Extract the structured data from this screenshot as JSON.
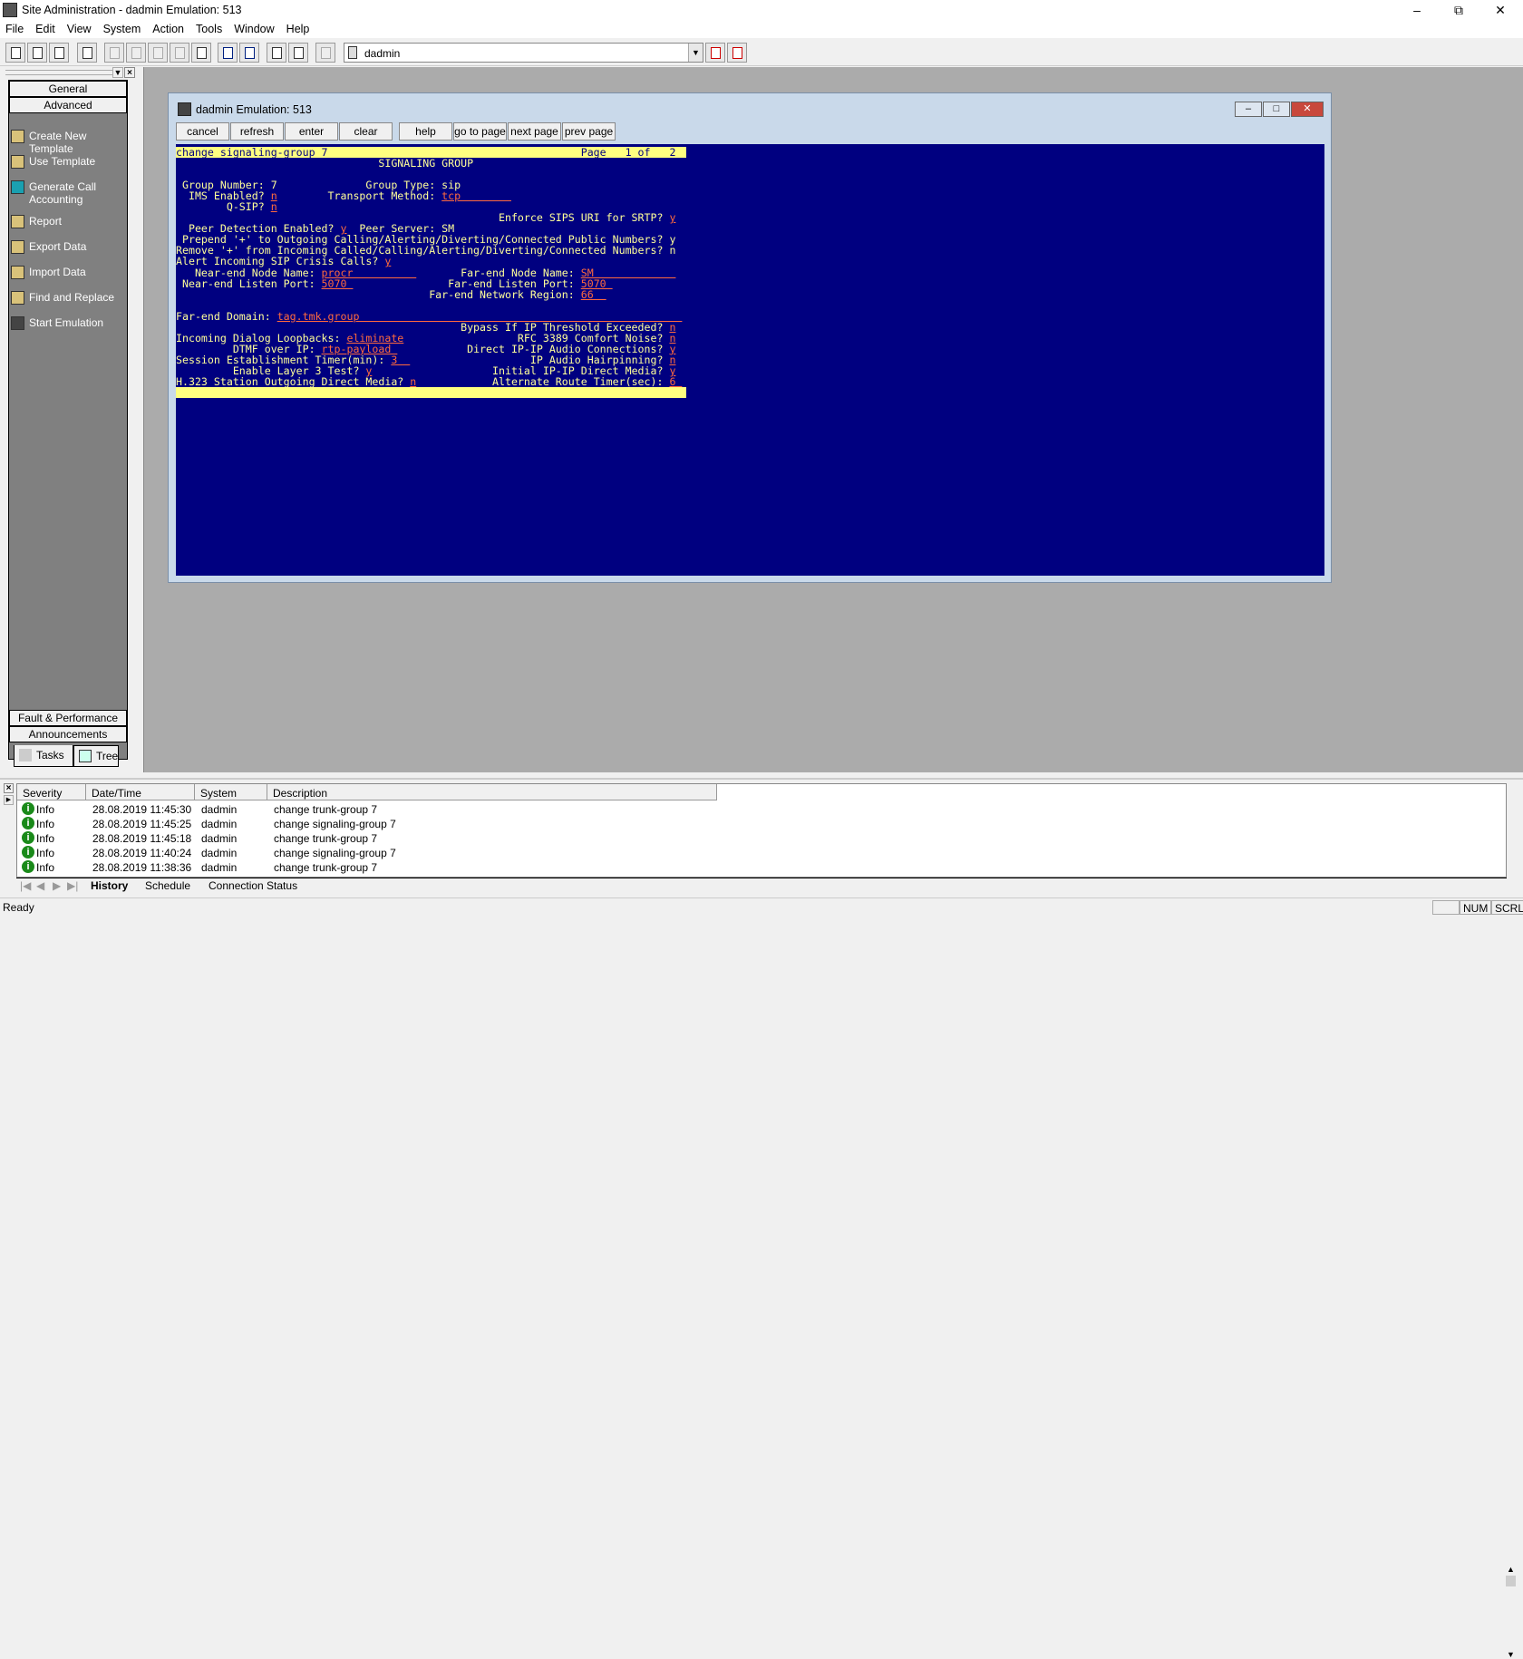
{
  "app": {
    "title": "Site Administration - dadmin Emulation: 513"
  },
  "menu": [
    "File",
    "Edit",
    "View",
    "System",
    "Action",
    "Tools",
    "Window",
    "Help"
  ],
  "toolbar": {
    "system_combo": "dadmin"
  },
  "left_panel": {
    "top_buttons": [
      "General",
      "Advanced"
    ],
    "items": [
      "Create New Template",
      "Use Template",
      "Generate Call Accounting",
      "Report",
      "Export Data",
      "Import Data",
      "Find and Replace",
      "Start Emulation"
    ],
    "bottom_buttons": [
      "Fault & Performance",
      "Announcements"
    ],
    "tabs": [
      "Tasks",
      "Tree"
    ]
  },
  "emulation": {
    "title": "dadmin Emulation: 513",
    "buttons": [
      "cancel",
      "refresh",
      "enter",
      "clear",
      "help",
      "go to page",
      "next page",
      "prev page"
    ],
    "colors": {
      "background": "#000080",
      "label": "#ffff99",
      "value": "#ff6a3d",
      "highlight": "#ffff80"
    },
    "screen": [
      {
        "hl": true,
        "segs": [
          [
            "change signaling-group 7                                        Page   1 of   2 ",
            "l"
          ]
        ]
      },
      {
        "segs": [
          [
            "                                SIGNALING GROUP",
            "l"
          ]
        ]
      },
      {
        "segs": []
      },
      {
        "segs": [
          [
            " Group Number: 7              Group Type: sip",
            "l"
          ]
        ]
      },
      {
        "segs": [
          [
            "  IMS Enabled? ",
            "l"
          ],
          [
            "n",
            "v"
          ],
          [
            "        Transport Method: ",
            "l"
          ],
          [
            "tcp        ",
            "v"
          ]
        ]
      },
      {
        "segs": [
          [
            "        Q-SIP? ",
            "l"
          ],
          [
            "n",
            "v"
          ]
        ]
      },
      {
        "segs": [
          [
            "                                                   Enforce SIPS URI for SRTP? ",
            "l"
          ],
          [
            "y",
            "v"
          ]
        ]
      },
      {
        "segs": [
          [
            "  Peer Detection Enabled? ",
            "l"
          ],
          [
            "y",
            "v"
          ],
          [
            "  Peer Server: SM",
            "l"
          ]
        ]
      },
      {
        "segs": [
          [
            " Prepend '+' to Outgoing Calling/Alerting/Diverting/Connected Public Numbers? y",
            "l"
          ]
        ]
      },
      {
        "segs": [
          [
            "Remove '+' from Incoming Called/Calling/Alerting/Diverting/Connected Numbers? n",
            "l"
          ]
        ]
      },
      {
        "segs": [
          [
            "Alert Incoming SIP Crisis Calls? ",
            "l"
          ],
          [
            "y",
            "v"
          ]
        ]
      },
      {
        "segs": [
          [
            "   Near-end Node Name: ",
            "l"
          ],
          [
            "procr          ",
            "v"
          ],
          [
            "       Far-end Node Name: ",
            "l"
          ],
          [
            "SM             ",
            "v"
          ]
        ]
      },
      {
        "segs": [
          [
            " Near-end Listen Port: ",
            "l"
          ],
          [
            "5070 ",
            "v"
          ],
          [
            "               Far-end Listen Port: ",
            "l"
          ],
          [
            "5070 ",
            "v"
          ]
        ]
      },
      {
        "segs": [
          [
            "                                        Far-end Network Region: ",
            "l"
          ],
          [
            "66  ",
            "v"
          ]
        ]
      },
      {
        "segs": []
      },
      {
        "segs": [
          [
            "Far-end Domain: ",
            "l"
          ],
          [
            "tag.tmk.group                                                   ",
            "v"
          ]
        ]
      },
      {
        "segs": [
          [
            "                                             Bypass If IP Threshold Exceeded? ",
            "l"
          ],
          [
            "n",
            "v"
          ]
        ]
      },
      {
        "segs": [
          [
            "Incoming Dialog Loopbacks: ",
            "l"
          ],
          [
            "eliminate",
            "v"
          ],
          [
            "                  RFC 3389 Comfort Noise? ",
            "l"
          ],
          [
            "n",
            "v"
          ]
        ]
      },
      {
        "segs": [
          [
            "         DTMF over IP: ",
            "l"
          ],
          [
            "rtp-payload ",
            "v"
          ],
          [
            "           Direct IP-IP Audio Connections? ",
            "l"
          ],
          [
            "y",
            "v"
          ]
        ]
      },
      {
        "segs": [
          [
            "Session Establishment Timer(min): ",
            "l"
          ],
          [
            "3  ",
            "v"
          ],
          [
            "                   IP Audio Hairpinning? ",
            "l"
          ],
          [
            "n",
            "v"
          ]
        ]
      },
      {
        "segs": [
          [
            "         Enable Layer 3 Test? ",
            "l"
          ],
          [
            "y",
            "v"
          ],
          [
            "                   Initial IP-IP Direct Media? ",
            "l"
          ],
          [
            "y",
            "v"
          ]
        ]
      },
      {
        "segs": [
          [
            "H.323 Station Outgoing Direct Media? ",
            "l"
          ],
          [
            "n",
            "v"
          ],
          [
            "            Alternate Route Timer(sec): ",
            "l"
          ],
          [
            "6 ",
            "v"
          ]
        ]
      },
      {
        "hl": true,
        "segs": [
          [
            "                                                                                ",
            "l"
          ]
        ]
      }
    ]
  },
  "log": {
    "columns": [
      "Severity",
      "Date/Time",
      "System",
      "Description"
    ],
    "rows": [
      {
        "severity": "Info",
        "datetime": "28.08.2019 11:45:30",
        "system": "dadmin",
        "description": "change trunk-group 7"
      },
      {
        "severity": "Info",
        "datetime": "28.08.2019 11:45:25",
        "system": "dadmin",
        "description": "change signaling-group 7"
      },
      {
        "severity": "Info",
        "datetime": "28.08.2019 11:45:18",
        "system": "dadmin",
        "description": "change trunk-group 7"
      },
      {
        "severity": "Info",
        "datetime": "28.08.2019 11:40:24",
        "system": "dadmin",
        "description": "change signaling-group 7"
      },
      {
        "severity": "Info",
        "datetime": "28.08.2019 11:38:36",
        "system": "dadmin",
        "description": "change trunk-group 7"
      }
    ],
    "tabs": [
      "History",
      "Schedule",
      "Connection Status"
    ],
    "active_tab": "History"
  },
  "status": {
    "text": "Ready",
    "num": "NUM",
    "scrl": "SCRL"
  }
}
